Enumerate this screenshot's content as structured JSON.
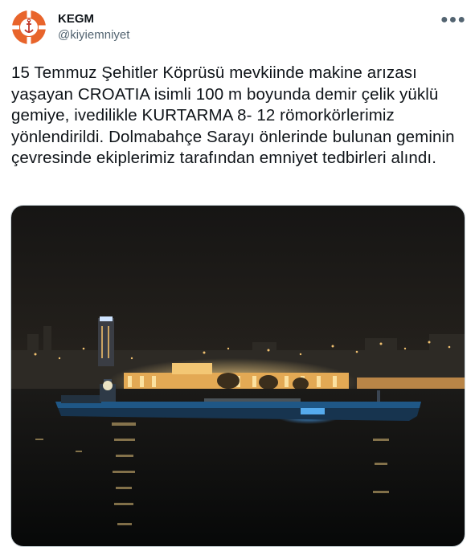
{
  "tweet": {
    "display_name": "KEGM",
    "handle": "@kiyiemniyet",
    "more_icon": "more-horizontal-icon",
    "text": "15 Temmuz Şehitler Köprüsü mevkiinde makine arızası yaşayan CROATIA isimli 100 m boyunda demir çelik yüklü gemiye, ivedilikle KURTARMA 8- 12 römorkörlerimiz yönlendirildi. Dolmabahçe Sarayı önlerinde bulunan geminin çevresinde ekiplerimiz tarafından emniyet tedbirleri alındı.",
    "avatar": {
      "icon": "lifebuoy-logo-icon",
      "ring_color": "#e8642b",
      "accent_color": "#ffffff"
    },
    "media": {
      "kind": "photo",
      "subject": "cargo ship at night near illuminated palace",
      "colors": {
        "sky": "#1c1a18",
        "water": "#0c0d0e",
        "palace_light": "#f2c46a",
        "hull": "#1d4f7a",
        "ship_light": "#3aa0ff"
      }
    },
    "colors": {
      "text": "#0f1419",
      "secondary": "#536471",
      "border": "#cfd9de"
    }
  }
}
